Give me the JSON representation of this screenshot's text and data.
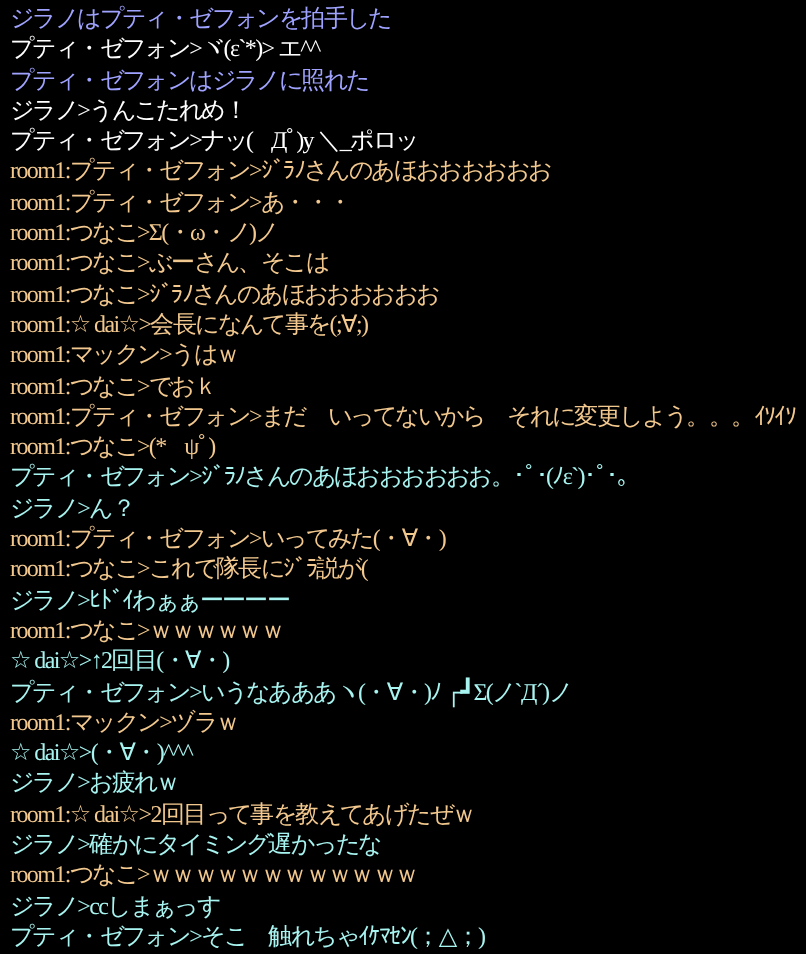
{
  "lines": [
    {
      "kind": "emote",
      "text": "ジラノはプティ・ゼフォンを拍手した"
    },
    {
      "kind": "say",
      "text": "プティ・ゼフォン>ヾ(ε`*)> エ^^"
    },
    {
      "kind": "emote",
      "text": "プティ・ゼフォンはジラノに照れた"
    },
    {
      "kind": "say",
      "text": "ジラノ>うんこたれめ！"
    },
    {
      "kind": "say",
      "text": "プティ・ゼフォン>ナッ(ﾟДﾟ)y ＼_ポロッ"
    },
    {
      "kind": "room",
      "text": "room1:プティ・ゼフォン>ｼﾞﾗﾉさんのあほおおおおおお"
    },
    {
      "kind": "room",
      "text": "room1:プティ・ゼフォン>あ・・・"
    },
    {
      "kind": "room",
      "text": "room1:つなこ>Σ(・ω・ノ)ノ"
    },
    {
      "kind": "room",
      "text": "room1:つなこ>ぶーさん、そこは"
    },
    {
      "kind": "room",
      "text": "room1:つなこ>ｼﾞﾗﾉさんのあほおおおおおお"
    },
    {
      "kind": "room",
      "text": "room1:☆ dai☆>会長になんて事を(;∀;)"
    },
    {
      "kind": "room",
      "text": "room1:マックン>うはｗ"
    },
    {
      "kind": "room",
      "text": "room1:つなこ>でおｋ"
    },
    {
      "kind": "room",
      "text": "room1:プティ・ゼフォン>まだ　いってないから　それに変更しよう。。。ｲｿｲｿ"
    },
    {
      "kind": "room",
      "text": "room1:つなこ>(*ﾟψﾟ)"
    },
    {
      "kind": "party",
      "text": "プティ・ゼフォン>ｼﾞﾗﾉさんのあほおおおおおお。･ﾟ･(ﾉε`)･ﾟ･。"
    },
    {
      "kind": "party",
      "text": "ジラノ>ん？"
    },
    {
      "kind": "room",
      "text": "room1:プティ・ゼフォン>いってみた(・∀・)"
    },
    {
      "kind": "room",
      "text": "room1:つなこ>これで隊長にｼﾞﾗ説が("
    },
    {
      "kind": "party",
      "text": "ジラノ>ﾋﾄﾞｲわぁぁーーーー"
    },
    {
      "kind": "room",
      "text": "room1:つなこ>ｗｗｗｗｗｗ"
    },
    {
      "kind": "party",
      "text": "☆ dai☆>↑2回目(・∀・)"
    },
    {
      "kind": "party",
      "text": "プティ・ゼフォン>いうなあああヽ(・∀・)ﾉ ┌┛Σ(ノ`Д´)ノ"
    },
    {
      "kind": "room",
      "text": "room1:マックン>ヅラｗ"
    },
    {
      "kind": "party",
      "text": "☆ dai☆>(・∀・)^^^"
    },
    {
      "kind": "party",
      "text": "ジラノ>お疲れｗ"
    },
    {
      "kind": "room",
      "text": "room1:☆ dai☆>2回目って事を教えてあげたぜｗ"
    },
    {
      "kind": "party",
      "text": "ジラノ>確かにタイミング遅かったな"
    },
    {
      "kind": "room",
      "text": "room1:つなこ>ｗｗｗｗｗｗｗｗｗｗｗｗ"
    },
    {
      "kind": "party",
      "text": "ジラノ>ccしまぁっす"
    },
    {
      "kind": "party",
      "text": "プティ・ゼフォン>そこ　触れちゃｲｹﾏｾﾝ(；△；)"
    }
  ]
}
